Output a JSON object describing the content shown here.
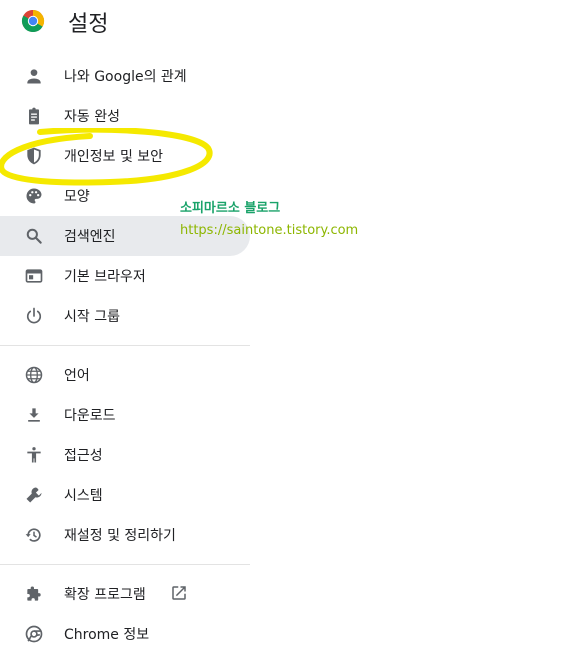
{
  "header": {
    "title": "설정",
    "logo_icon": "chrome-logo-icon"
  },
  "nav": {
    "group1": [
      {
        "label": "나와 Google의 관계",
        "icon": "person-icon"
      },
      {
        "label": "자동 완성",
        "icon": "clipboard-icon"
      },
      {
        "label": "개인정보 및 보안",
        "icon": "shield-icon"
      },
      {
        "label": "모양",
        "icon": "palette-icon"
      },
      {
        "label": "검색엔진",
        "icon": "search-icon",
        "active": true
      },
      {
        "label": "기본 브라우저",
        "icon": "browser-window-icon"
      },
      {
        "label": "시작 그룹",
        "icon": "power-icon"
      }
    ],
    "group2": [
      {
        "label": "언어",
        "icon": "globe-icon"
      },
      {
        "label": "다운로드",
        "icon": "download-icon"
      },
      {
        "label": "접근성",
        "icon": "accessibility-icon"
      },
      {
        "label": "시스템",
        "icon": "wrench-icon"
      },
      {
        "label": "재설정 및 정리하기",
        "icon": "restore-icon"
      }
    ],
    "group3": [
      {
        "label": "확장 프로그램",
        "icon": "puzzle-icon",
        "external_icon": "open-in-new-icon"
      },
      {
        "label": "Chrome 정보",
        "icon": "chrome-logo-icon"
      }
    ]
  },
  "watermark": {
    "name": "소피마르소 블로그",
    "url": "https://saintone.tistory.com"
  },
  "colors": {
    "active_bg": "#e8eaed",
    "icon": "#5f6368",
    "highlight": "#f5e900",
    "watermark_name": "#1aa36a",
    "watermark_url": "#8db600"
  }
}
